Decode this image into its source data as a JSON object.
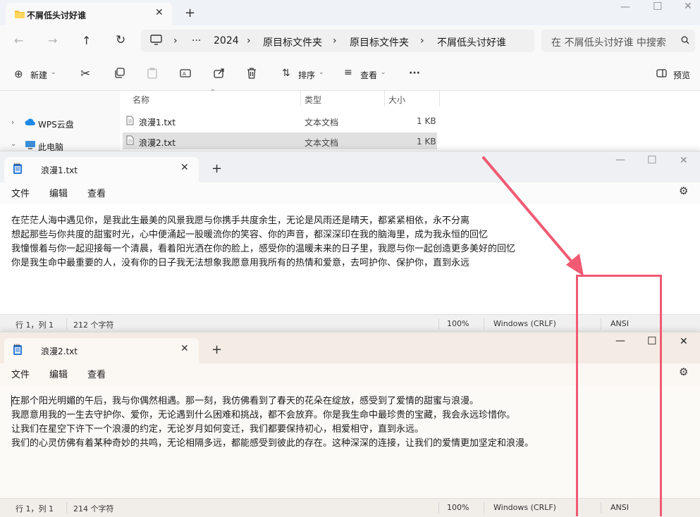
{
  "explorer": {
    "tab_title": "不屑低头讨好谁",
    "breadcrumb": [
      "2024",
      "原目标文件夹",
      "原目标文件夹",
      "不屑低头讨好谁"
    ],
    "ellipsis": "···",
    "search_placeholder": "在 不屑低头讨好谁 中搜索",
    "cmd": {
      "new": "新建",
      "sort": "排序",
      "view": "查看",
      "more": "···",
      "preview": "预览"
    },
    "nav": {
      "wps": "WPS云盘",
      "pc": "此电脑"
    },
    "columns": {
      "name": "名称",
      "type": "类型",
      "size": "大小"
    },
    "files": [
      {
        "name": "浪漫1.txt",
        "type": "文本文档",
        "size": "1 KB"
      },
      {
        "name": "浪漫2.txt",
        "type": "文本文档",
        "size": "1 KB"
      }
    ]
  },
  "menus": {
    "file": "文件",
    "edit": "编辑",
    "view": "查看"
  },
  "notepad1": {
    "tab_title": "浪漫1.txt",
    "lines": [
      "在茫茫人海中遇见你，是我此生最美的风景我愿与你携手共度余生，无论是风雨还是晴天，都紧紧相依，永不分离",
      "想起那些与你共度的甜蜜时光，心中便涌起一股暖流你的笑容、你的声音，都深深印在我的脑海里，成为我永恒的回忆",
      "我憧憬着与你一起迎接每一个清晨，看着阳光洒在你的脸上，感受你的温暖未来的日子里，我愿与你一起创造更多美好的回忆",
      "你是我生命中最重要的人，没有你的日子我无法想象我愿意用我所有的热情和爱意，去呵护你、保护你，直到永远"
    ],
    "status": {
      "pos": "行 1，列 1",
      "chars": "212 个字符",
      "zoom": "100%",
      "eol": "Windows (CRLF)",
      "enc": "ANSI"
    }
  },
  "notepad2": {
    "tab_title": "浪漫2.txt",
    "lines": [
      "在那个阳光明媚的午后，我与你偶然相遇。那一刻，我仿佛看到了春天的花朵在绽放，感受到了爱情的甜蜜与浪漫。",
      "我愿意用我的一生去守护你、爱你，无论遇到什么困难和挑战，都不会放弃。你是我生命中最珍贵的宝藏，我会永远珍惜你。",
      "让我们在星空下许下一个浪漫的约定，无论岁月如何变迁，我们都要保持初心，相爱相守，直到永远。",
      "我们的心灵仿佛有着某种奇妙的共鸣，无论相隔多远，都能感受到彼此的存在。这种深深的连接，让我们的爱情更加坚定和浪漫。"
    ],
    "status": {
      "pos": "行 1，列 1",
      "chars": "214 个字符",
      "zoom": "100%",
      "eol": "Windows (CRLF)",
      "enc": "ANSI"
    }
  },
  "colors": {
    "annotation": "#f05a72",
    "accent": "#0067c0"
  }
}
